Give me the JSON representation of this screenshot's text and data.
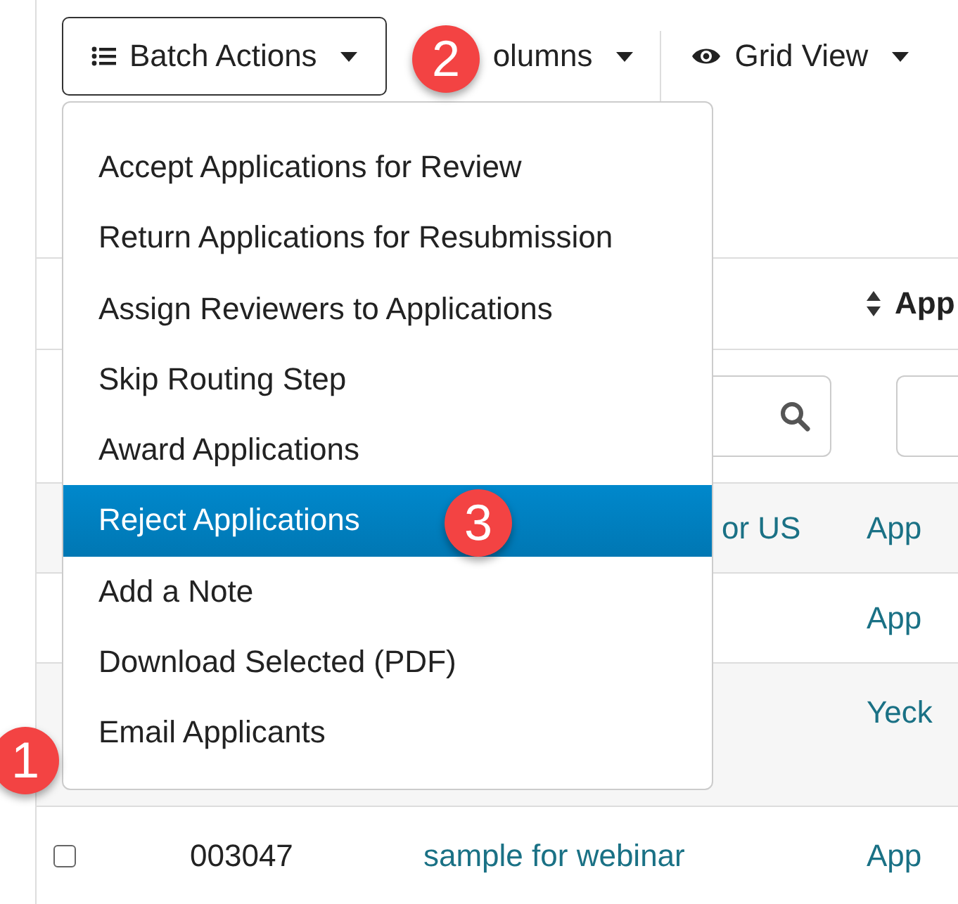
{
  "toolbar": [
    {
      "label": "Batch Actions"
    },
    {
      "label": "olumns"
    },
    {
      "label": "Grid View"
    }
  ],
  "table": {
    "columns": [
      {
        "label": "App"
      }
    ],
    "rows": [
      {
        "title": "or US",
        "column_4": "App"
      },
      {
        "column_4": "App"
      },
      {
        "column_4": "Yeck"
      },
      {
        "checked": false,
        "id": "003047",
        "title": "sample for webinar",
        "column_4": "App"
      }
    ]
  },
  "menu": {
    "items": [
      {
        "label": "Accept Applications for Review",
        "selected": false
      },
      {
        "label": "Return Applications for Resubmission",
        "selected": false
      },
      {
        "label": "Assign Reviewers to Applications",
        "selected": false
      },
      {
        "label": "Skip Routing Step",
        "selected": false
      },
      {
        "label": "Award Applications",
        "selected": false
      },
      {
        "label": "Reject Applications",
        "selected": true
      },
      {
        "label": "Add a Note",
        "selected": false
      },
      {
        "label": "Download Selected (PDF)",
        "selected": false
      },
      {
        "label": "Email Applicants",
        "selected": false
      }
    ]
  },
  "callouts": [
    {
      "number": "2"
    },
    {
      "number": "3"
    },
    {
      "number": "1"
    }
  ]
}
